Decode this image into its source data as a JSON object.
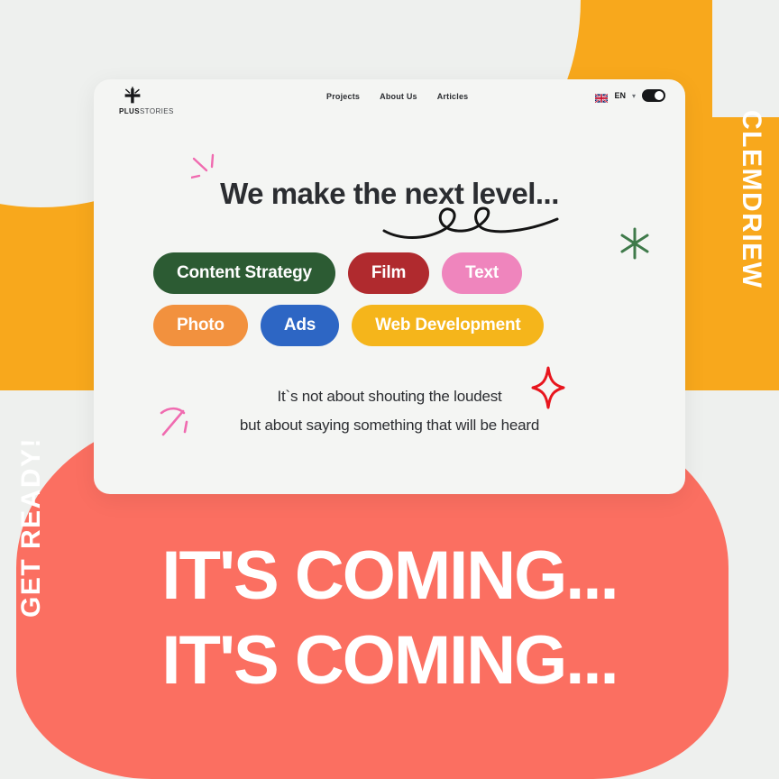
{
  "poster": {
    "background_color": "#eef0ee",
    "orange_color": "#f8a81c",
    "coral_color": "#fb6f61",
    "side_label_right": "CLEMDRIEW",
    "side_label_left": "GET READY!",
    "big_copy": [
      "IT'S COMING...",
      "IT'S COMING..."
    ]
  },
  "card": {
    "nav": {
      "brand": {
        "name_bold": "PLUS",
        "name_light": "STORIES",
        "mark": "plus-mark-icon"
      },
      "links": [
        {
          "label": "Projects"
        },
        {
          "label": "About Us"
        },
        {
          "label": "Articles"
        }
      ],
      "language": {
        "flag": "uk-flag-icon",
        "code": "EN",
        "chevron": "chevron-down-icon"
      },
      "theme_toggle": {
        "state": "on",
        "icon": "toggle-switch-icon"
      }
    },
    "headline": {
      "light_part": "We make ",
      "bold_part": "the next level...",
      "underline": "hand-drawn-squiggle-icon"
    },
    "pills": {
      "row1": [
        {
          "label": "Content Strategy",
          "color": "#2c5b33"
        },
        {
          "label": "Film",
          "color": "#b02a2e"
        },
        {
          "label": "Text",
          "color": "#ef85bd"
        }
      ],
      "row2": [
        {
          "label": "Photo",
          "color": "#f2913e"
        },
        {
          "label": "Ads",
          "color": "#2d66c4"
        },
        {
          "label": "Web Development",
          "color": "#f5b51b"
        }
      ]
    },
    "tagline": {
      "line1": "It`s not about shouting the loudest",
      "line2": "but about saying something that will be heard"
    },
    "decorations": {
      "green_asterisk": {
        "icon": "asterisk-star-icon",
        "color": "#3f7a4a"
      },
      "red_sparkle": {
        "icon": "four-point-sparkle-icon",
        "color": "#e8151d"
      },
      "pink_ticks_top": {
        "icon": "pink-tick-marks-icon",
        "color": "#f06bb0"
      },
      "pink_ticks_bottom": {
        "icon": "pink-tick-marks-icon",
        "color": "#f06bb0"
      }
    }
  }
}
